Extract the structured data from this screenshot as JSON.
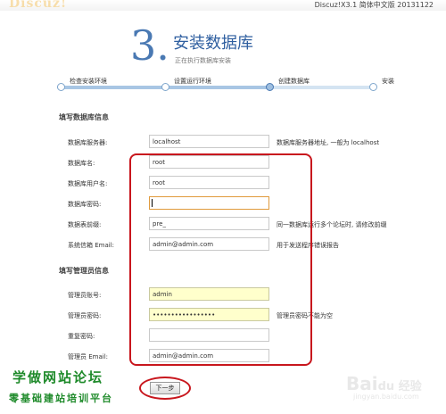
{
  "header": {
    "version": "Discuz!X3.1 简体中文版 20131122"
  },
  "step": {
    "number": "3.",
    "title": "安装数据库",
    "subtitle": "正在执行数据库安装"
  },
  "progress": {
    "steps": [
      "检查安装环境",
      "设置运行环境",
      "创建数据库",
      "安装"
    ],
    "current_index": 2
  },
  "db_section": {
    "title": "填写数据库信息",
    "fields": [
      {
        "label": "数据库服务器:",
        "value": "localhost",
        "hint": "数据库服务器地址, 一般为 localhost"
      },
      {
        "label": "数据库名:",
        "value": "root",
        "hint": ""
      },
      {
        "label": "数据库用户名:",
        "value": "root",
        "hint": ""
      },
      {
        "label": "数据库密码:",
        "value": "",
        "hint": ""
      },
      {
        "label": "数据表前缀:",
        "value": "pre_",
        "hint": "同一数据库运行多个论坛时, 请修改前缀"
      },
      {
        "label": "系统信箱 Email:",
        "value": "admin@admin.com",
        "hint": "用于发送程序错误报告"
      }
    ]
  },
  "admin_section": {
    "title": "填写管理员信息",
    "fields": [
      {
        "label": "管理员账号:",
        "value": "admin",
        "hint": ""
      },
      {
        "label": "管理员密码:",
        "value": "•••••••••••••••••",
        "hint": "管理员密码不能为空"
      },
      {
        "label": "重复密码:",
        "value": "",
        "hint": ""
      },
      {
        "label": "管理员 Email:",
        "value": "admin@admin.com",
        "hint": ""
      }
    ]
  },
  "next_button": "下一步",
  "watermark": {
    "line1": "学做网站论坛",
    "line2": "零基础建站培训平台",
    "baidu": "Bai",
    "baidu_suffix": "du 经验",
    "baidu_sub": "jingyan.baidu.com"
  },
  "colors": {
    "accent_blue": "#4a79b3",
    "annotation_red": "#c8161d",
    "watermark_green": "#1e8a2a",
    "autofill_yellow": "#ffffcc"
  }
}
